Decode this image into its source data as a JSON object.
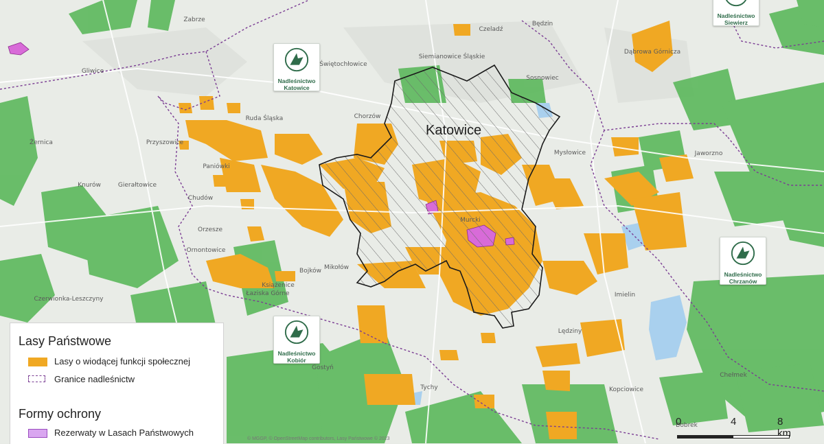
{
  "map": {
    "center_label": "Katowice",
    "places": [
      {
        "name": "Zabrze"
      },
      {
        "name": "Gliwice"
      },
      {
        "name": "Świętochłowice"
      },
      {
        "name": "Chorzów"
      },
      {
        "name": "Siemianowice Śląskie"
      },
      {
        "name": "Czeladź"
      },
      {
        "name": "Będzin"
      },
      {
        "name": "Sosnowiec"
      },
      {
        "name": "Dąbrowa Górnicza"
      },
      {
        "name": "Ruda Śląska"
      },
      {
        "name": "Mysłowice"
      },
      {
        "name": "Jaworzno"
      },
      {
        "name": "Knurów"
      },
      {
        "name": "Gierałtowice"
      },
      {
        "name": "Mikołów"
      },
      {
        "name": "Tychy"
      },
      {
        "name": "Czerwionka-Leszczyny"
      },
      {
        "name": "Imielin"
      },
      {
        "name": "Lędziny"
      },
      {
        "name": "Chełmek"
      },
      {
        "name": "Murcki"
      },
      {
        "name": "Łaziska Górne"
      },
      {
        "name": "Orzesze"
      },
      {
        "name": "Żernica"
      },
      {
        "name": "Paniówki"
      },
      {
        "name": "Przyszowice"
      },
      {
        "name": "Chudów"
      },
      {
        "name": "Ornontowice"
      },
      {
        "name": "Bojków"
      },
      {
        "name": "Gostyń"
      },
      {
        "name": "Kopciowice"
      },
      {
        "name": "Bobrek"
      },
      {
        "name": "Książenice"
      }
    ]
  },
  "badges": [
    {
      "line1": "Nadleśnictwo",
      "line2": "Katowice"
    },
    {
      "line1": "Nadleśnictwo",
      "line2": "Siewierz"
    },
    {
      "line1": "Nadleśnictwo",
      "line2": "Chrzanów"
    },
    {
      "line1": "Nadleśnictwo",
      "line2": "Kobiór"
    }
  ],
  "legend": {
    "title1": "Lasy Państwowe",
    "item1": "Lasy o wiodącej funkcji społecznej",
    "item2": "Granice nadleśnictw",
    "title2": "Formy ochrony",
    "item3": "Rezerwaty w Lasach Państwowych"
  },
  "scale": {
    "t0": "0",
    "t1": "4",
    "t2": "8 km"
  },
  "credit": "© MGGP, © OpenStreetMap contributors, Lasy Państwowe © 2023",
  "colors": {
    "social_forest": "#f0a823",
    "forest_green": "#5cb85c",
    "reserve": "#d86bd8",
    "boundary": "#7a3c93",
    "water": "#a9d0ee",
    "background": "#e8ebe6"
  }
}
